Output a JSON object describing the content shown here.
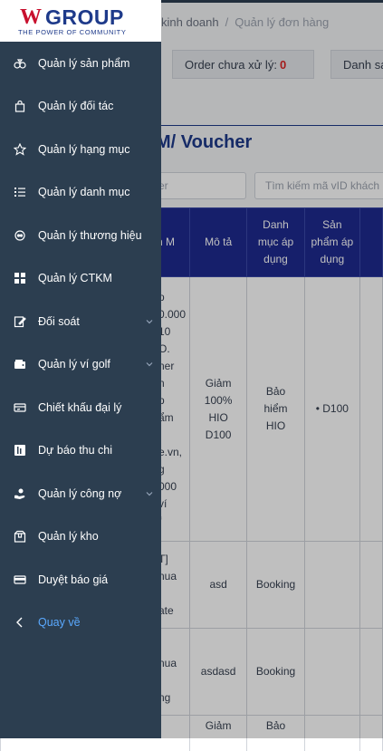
{
  "breadcrumb": {
    "parent": "kinh doanh",
    "separator": "/",
    "current": "Quản lý đơn hàng"
  },
  "stats": {
    "pending_label": "Order chưa xử lý:",
    "pending_count": "0",
    "next_label": "Danh sá"
  },
  "page_title": "M/ Voucher",
  "search": {
    "first_placeholder": "er",
    "second_placeholder": "Tìm kiếm mã vID khách l"
  },
  "table": {
    "headers": [
      "n\nM",
      "Mô tả",
      "Danh\nmục áp\ndụng",
      "Sản\nphẩm áp\ndụng",
      ""
    ],
    "rows": [
      {
        "col1": "p\n0.000\n10\nO.\nner\nn\np\nẩm\n\ne.vn,\ng\n000\nví\nf",
        "desc": "Giảm\n100%\nHIO\nD100",
        "category": "Bảo\nhiểm\nHIO",
        "product": "• D100"
      },
      {
        "col1": "T]\nnua\n\nate",
        "desc": "asd",
        "category": "Booking",
        "product": ""
      },
      {
        "col1": "]\nnua\n\nng",
        "desc": "asdasd",
        "category": "Booking",
        "product": ""
      },
      {
        "col1": "",
        "desc": "Giảm",
        "category": "Bảo",
        "product": ""
      }
    ]
  },
  "sidebar": {
    "logo": {
      "mark": "W",
      "name": "GROUP",
      "tagline": "THE POWER OF COMMUNITY"
    },
    "items": [
      {
        "label": "Quản lý sản phẩm",
        "icon": "box-stack-icon",
        "expandable": false
      },
      {
        "label": "Quản lý đối tác",
        "icon": "shopping-bag-icon",
        "expandable": false
      },
      {
        "label": "Quản lý hạng mục",
        "icon": "star-icon",
        "expandable": false
      },
      {
        "label": "Quản lý danh mục",
        "icon": "list-icon",
        "expandable": false
      },
      {
        "label": "Quản lý thương hiệu",
        "icon": "badge-icon",
        "expandable": false
      },
      {
        "label": "Quản lý CTKM",
        "icon": "grid-icon",
        "expandable": false
      },
      {
        "label": "Đối soát",
        "icon": "edit-doc-icon",
        "expandable": true
      },
      {
        "label": "Quản lý ví golf",
        "icon": "wallet-icon",
        "expandable": true
      },
      {
        "label": "Chiết khấu đại lý",
        "icon": "card-discount-icon",
        "expandable": false
      },
      {
        "label": "Dự báo thu chi",
        "icon": "forecast-icon",
        "expandable": false
      },
      {
        "label": "Quản lý công nợ",
        "icon": "hand-coin-icon",
        "expandable": true
      },
      {
        "label": "Quản lý kho",
        "icon": "warehouse-icon",
        "expandable": false
      },
      {
        "label": "Duyệt báo giá",
        "icon": "credit-card-icon",
        "expandable": false
      },
      {
        "label": "Quay về",
        "icon": "chevron-left-icon",
        "expandable": false
      }
    ]
  },
  "colors": {
    "sidebar_bg": "#2c3e50",
    "accent_blue": "#1e3a8a",
    "table_header": "#1e2a8f",
    "back_link": "#5aa9ff",
    "alert_red": "#dc2626"
  }
}
